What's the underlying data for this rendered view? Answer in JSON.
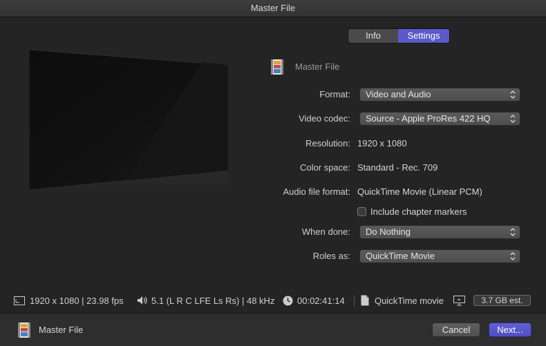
{
  "window": {
    "title": "Master File"
  },
  "tabs": [
    {
      "label": "Info"
    },
    {
      "label": "Settings",
      "active": true
    }
  ],
  "header": {
    "name": "Master File",
    "icon": "filmstrip-icon"
  },
  "settings": {
    "format": {
      "label": "Format:",
      "value": "Video and Audio"
    },
    "video_codec": {
      "label": "Video codec:",
      "value": "Source - Apple ProRes 422 HQ"
    },
    "resolution": {
      "label": "Resolution:",
      "value": "1920 x 1080"
    },
    "color_space": {
      "label": "Color space:",
      "value": "Standard - Rec. 709"
    },
    "audio_file_format": {
      "label": "Audio file format:",
      "value": "QuickTime Movie (Linear PCM)"
    },
    "chapter_markers": {
      "label": "Include chapter markers",
      "checked": false
    },
    "when_done": {
      "label": "When done:",
      "value": "Do Nothing"
    },
    "roles_as": {
      "label": "Roles as:",
      "value": "QuickTime Movie"
    }
  },
  "infobar": {
    "video": "1920 x 1080 | 23.98 fps",
    "audio": "5.1 (L R C LFE Ls Rs) | 48 kHz",
    "duration": "00:02:41:14",
    "file_type": "QuickTime movie",
    "size_estimate": "3.7 GB est."
  },
  "footer": {
    "name": "Master File",
    "cancel_label": "Cancel",
    "next_label": "Next..."
  },
  "colors": {
    "accent": "#5b58c8",
    "background": "#242424"
  }
}
